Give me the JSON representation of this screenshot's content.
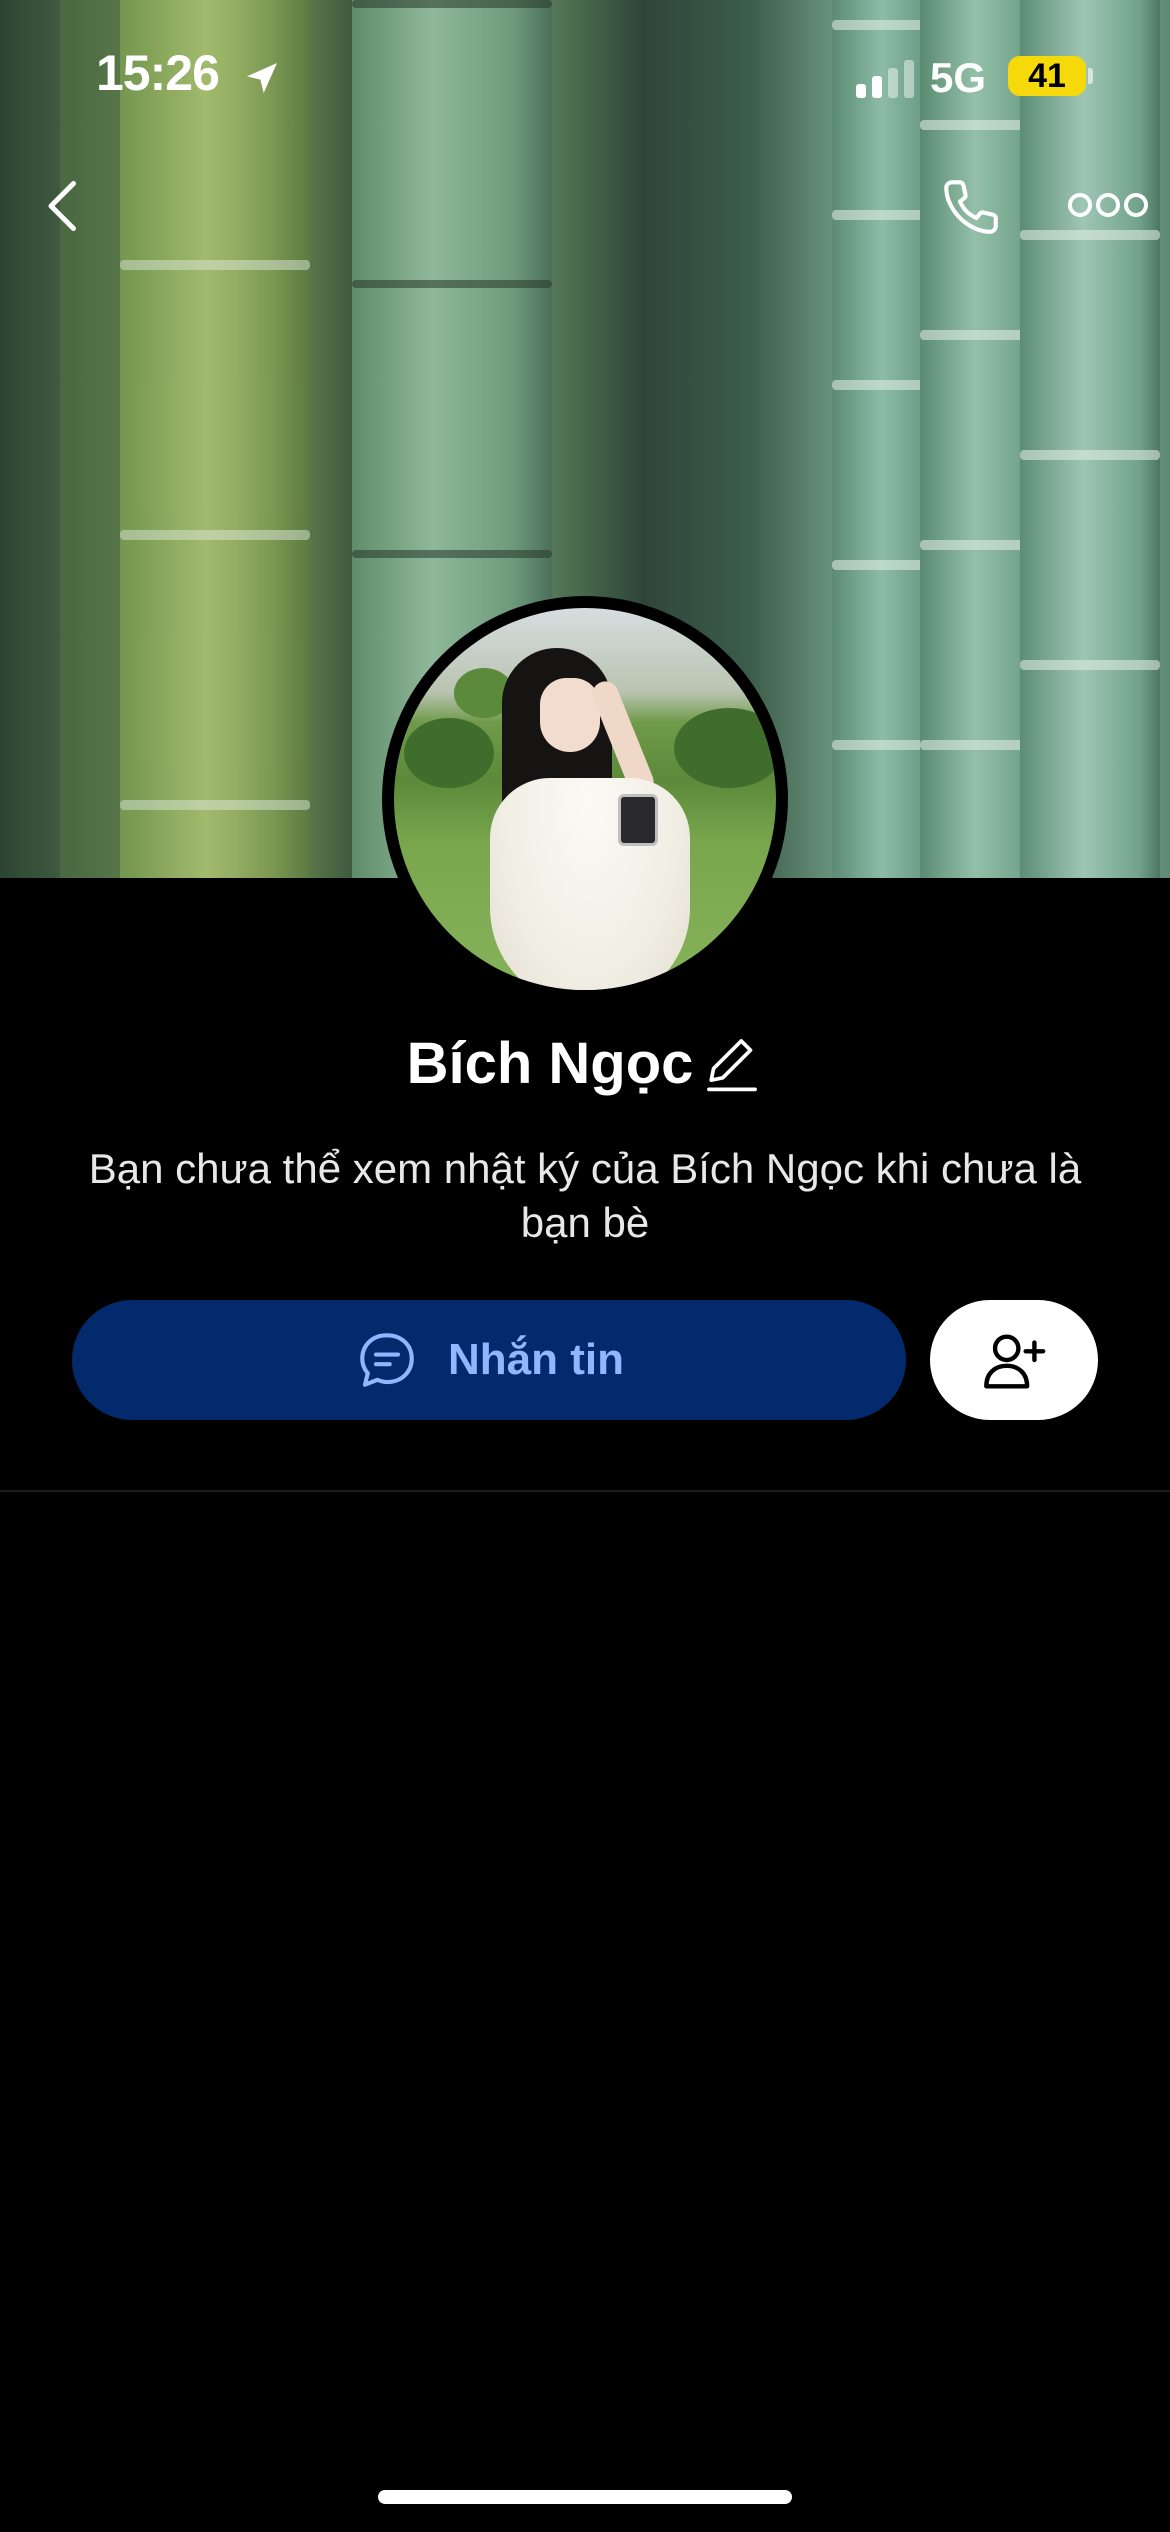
{
  "status_bar": {
    "time": "15:26",
    "network": "5G",
    "battery": "41",
    "battery_color": "#f5d90a"
  },
  "nav": {
    "back_icon": "chevron-left-icon",
    "call_icon": "phone-icon",
    "more_icon": "ellipsis-icon"
  },
  "profile": {
    "name": "Bích Ngọc",
    "subtitle": "Bạn chưa thể xem nhật ký của Bích Ngọc khi chưa là bạn bè"
  },
  "actions": {
    "message_label": "Nhắn tin",
    "message_button_color": "#022a6c",
    "message_text_color": "#8fb7ff",
    "add_friend_icon": "add-user-icon"
  }
}
